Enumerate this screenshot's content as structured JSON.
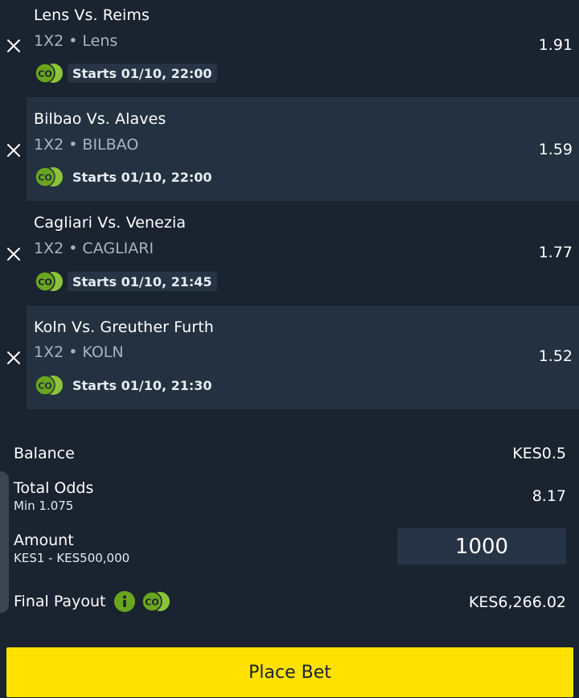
{
  "bets": [
    {
      "match": "Lens Vs. Reims",
      "market": "1X2",
      "selection": "Lens",
      "odds": "1.91",
      "starts": "Starts 01/10, 22:00",
      "boost_icon": "co-coin-icon"
    },
    {
      "match": "Bilbao Vs. Alaves",
      "market": "1X2",
      "selection": "BILBAO",
      "odds": "1.59",
      "starts": "Starts 01/10, 22:00",
      "boost_icon": "co-coin-icon"
    },
    {
      "match": "Cagliari Vs. Venezia",
      "market": "1X2",
      "selection": "CAGLIARI",
      "odds": "1.77",
      "starts": "Starts 01/10, 21:45",
      "boost_icon": "co-coin-icon"
    },
    {
      "match": "Koln Vs. Greuther Furth",
      "market": "1X2",
      "selection": "KOLN",
      "odds": "1.52",
      "starts": "Starts 01/10, 21:30",
      "boost_icon": "co-coin-icon"
    }
  ],
  "summary": {
    "balance_label": "Balance",
    "balance_value": "KES0.5",
    "total_odds_label": "Total Odds",
    "total_odds_min": "Min 1.075",
    "total_odds_value": "8.17",
    "amount_label": "Amount",
    "amount_range": "KES1 - KES500,000",
    "amount_value": "1000",
    "payout_label": "Final Payout",
    "payout_value": "KES6,266.02"
  },
  "place_bet_label": "Place Bet",
  "colors": {
    "background": "#1a2330",
    "row_alt": "#243140",
    "accent_yellow": "#ffe100",
    "coin_green": "#6aa51e",
    "muted_text": "#aab3bf"
  },
  "icons": [
    "close-icon",
    "co-coin-icon",
    "info-icon"
  ]
}
